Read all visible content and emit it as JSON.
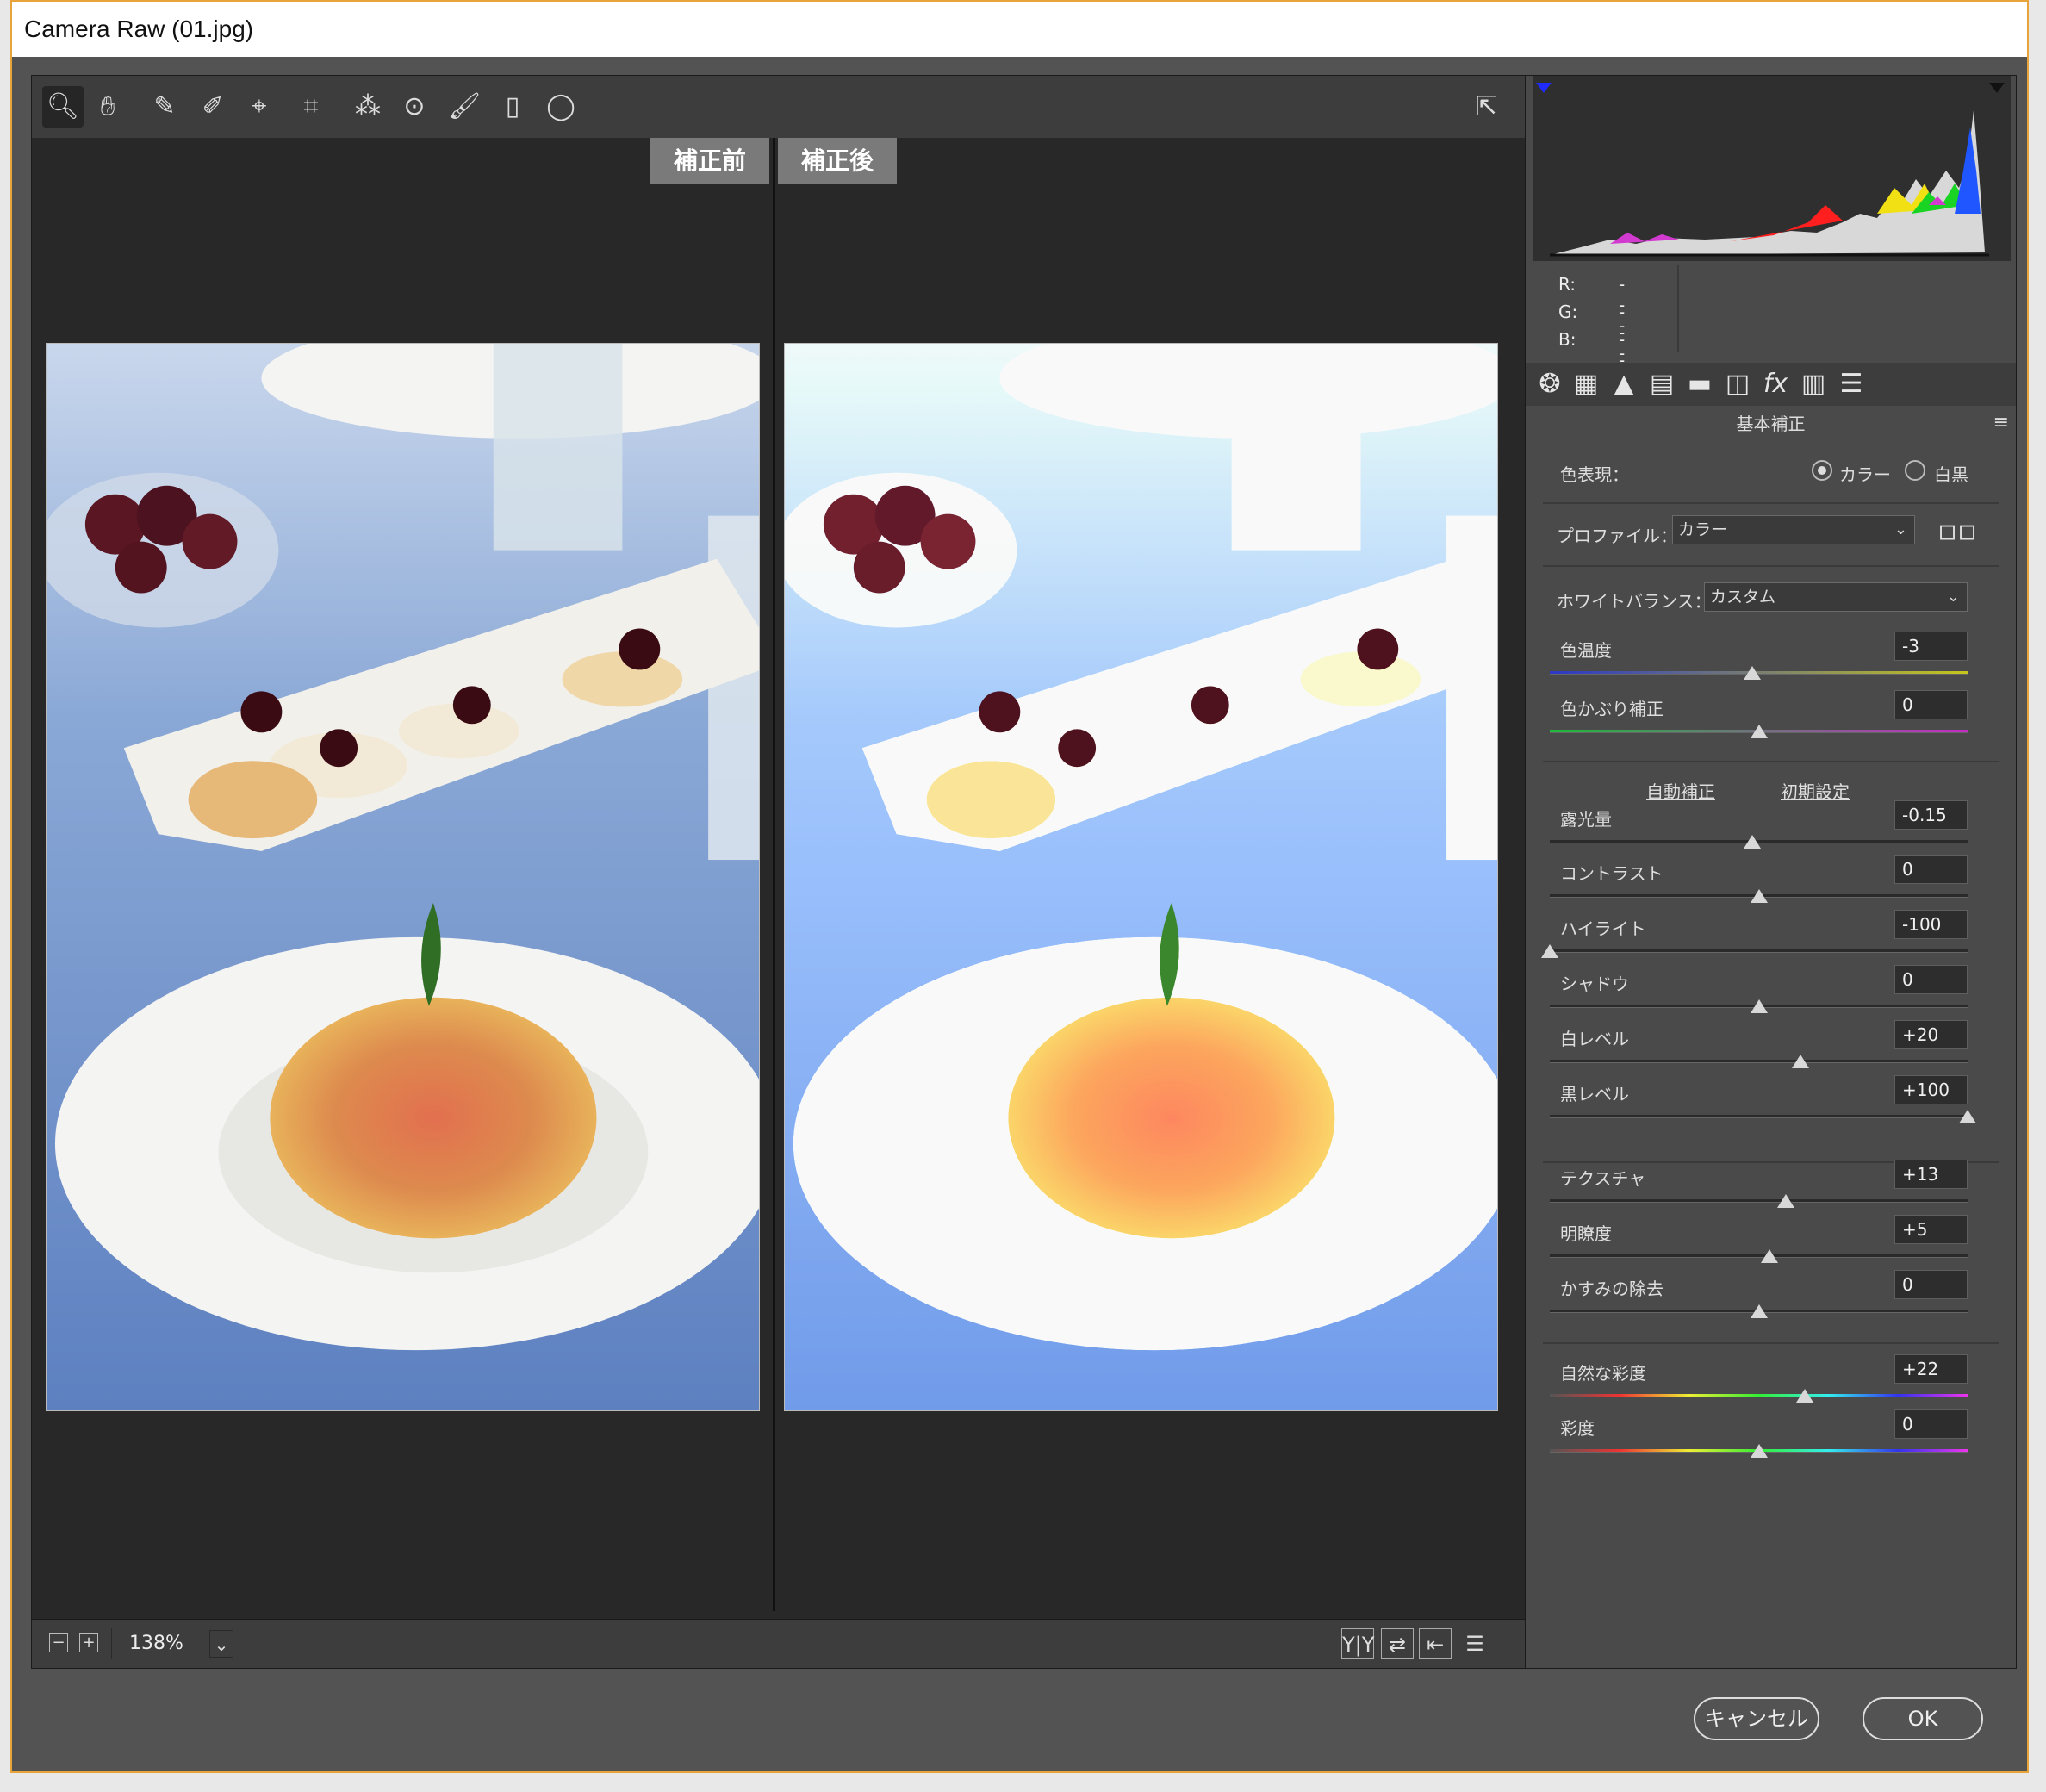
{
  "window": {
    "title": "Camera Raw (01.jpg)"
  },
  "toolbar": {
    "tools": [
      "zoom-icon",
      "hand-icon",
      "eyedropper-icon",
      "color-sampler-icon",
      "target-adjust-icon",
      "transform-icon",
      "spot-removal-icon",
      "red-eye-icon",
      "adjustment-brush-icon",
      "graduated-filter-icon",
      "radial-filter-icon"
    ],
    "active_tool": "zoom-icon",
    "open_prefs_icon": "export-icon"
  },
  "preview": {
    "before_label": "補正前",
    "after_label": "補正後",
    "zoom_minus": "−",
    "zoom_plus": "+",
    "zoom": "138%"
  },
  "rgb": {
    "r_label": "R:",
    "g_label": "G:",
    "b_label": "B:",
    "r": "---",
    "g": "---",
    "b": "---"
  },
  "panel": {
    "title": "基本補正",
    "treatment_label": "色表現：",
    "treatment_color": "カラー",
    "treatment_bw": "白黒",
    "treatment_selected": "カラー",
    "profile_label": "プロファイル：",
    "profile_value": "カラー",
    "wb_label": "ホワイトバランス：",
    "wb_value": "カスタム",
    "auto_label": "自動補正",
    "default_label": "初期設定",
    "sliders": [
      {
        "label": "色温度",
        "value": "-3",
        "pos": 0.485
      },
      {
        "label": "色かぶり補正",
        "value": "0",
        "pos": 0.5
      },
      {
        "label": "露光量",
        "value": "-0.15",
        "pos": 0.485
      },
      {
        "label": "コントラスト",
        "value": "0",
        "pos": 0.5
      },
      {
        "label": "ハイライト",
        "value": "-100",
        "pos": 0.0
      },
      {
        "label": "シャドウ",
        "value": "0",
        "pos": 0.5
      },
      {
        "label": "白レベル",
        "value": "+20",
        "pos": 0.6
      },
      {
        "label": "黒レベル",
        "value": "+100",
        "pos": 1.0
      },
      {
        "label": "テクスチャ",
        "value": "+13",
        "pos": 0.565
      },
      {
        "label": "明瞭度",
        "value": "+5",
        "pos": 0.525
      },
      {
        "label": "かすみの除去",
        "value": "0",
        "pos": 0.5
      },
      {
        "label": "自然な彩度",
        "value": "+22",
        "pos": 0.61
      },
      {
        "label": "彩度",
        "value": "0",
        "pos": 0.5
      }
    ]
  },
  "footer": {
    "cancel_label": "キャンセル",
    "ok_label": "OK"
  }
}
